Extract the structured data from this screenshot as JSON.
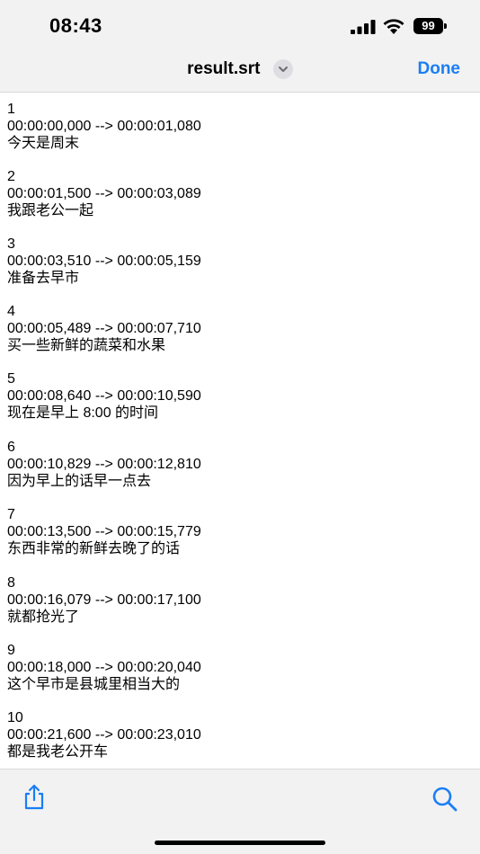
{
  "status_bar": {
    "time": "08:43",
    "battery_level": "99"
  },
  "nav": {
    "title": "result.srt",
    "done_label": "Done"
  },
  "subtitles": [
    {
      "index": "1",
      "timing": "00:00:00,000 --> 00:00:01,080",
      "text": "今天是周末"
    },
    {
      "index": "2",
      "timing": "00:00:01,500 --> 00:00:03,089",
      "text": "我跟老公一起"
    },
    {
      "index": "3",
      "timing": "00:00:03,510 --> 00:00:05,159",
      "text": "准备去早市"
    },
    {
      "index": "4",
      "timing": "00:00:05,489 --> 00:00:07,710",
      "text": "买一些新鲜的蔬菜和水果"
    },
    {
      "index": "5",
      "timing": "00:00:08,640 --> 00:00:10,590",
      "text": "现在是早上 8:00 的时间"
    },
    {
      "index": "6",
      "timing": "00:00:10,829 --> 00:00:12,810",
      "text": "因为早上的话早一点去"
    },
    {
      "index": "7",
      "timing": "00:00:13,500 --> 00:00:15,779",
      "text": "东西非常的新鲜去晚了的话"
    },
    {
      "index": "8",
      "timing": "00:00:16,079 --> 00:00:17,100",
      "text": "就都抢光了"
    },
    {
      "index": "9",
      "timing": "00:00:18,000 --> 00:00:20,040",
      "text": "这个早市是县城里相当大的"
    },
    {
      "index": "10",
      "timing": "00:00:21,600 --> 00:00:23,010",
      "text": "都是我老公开车"
    }
  ],
  "icons": {
    "share": "share-icon",
    "search": "search-icon",
    "title_menu": "chevron-down-icon"
  },
  "colors": {
    "accent": "#1a7ef5"
  }
}
